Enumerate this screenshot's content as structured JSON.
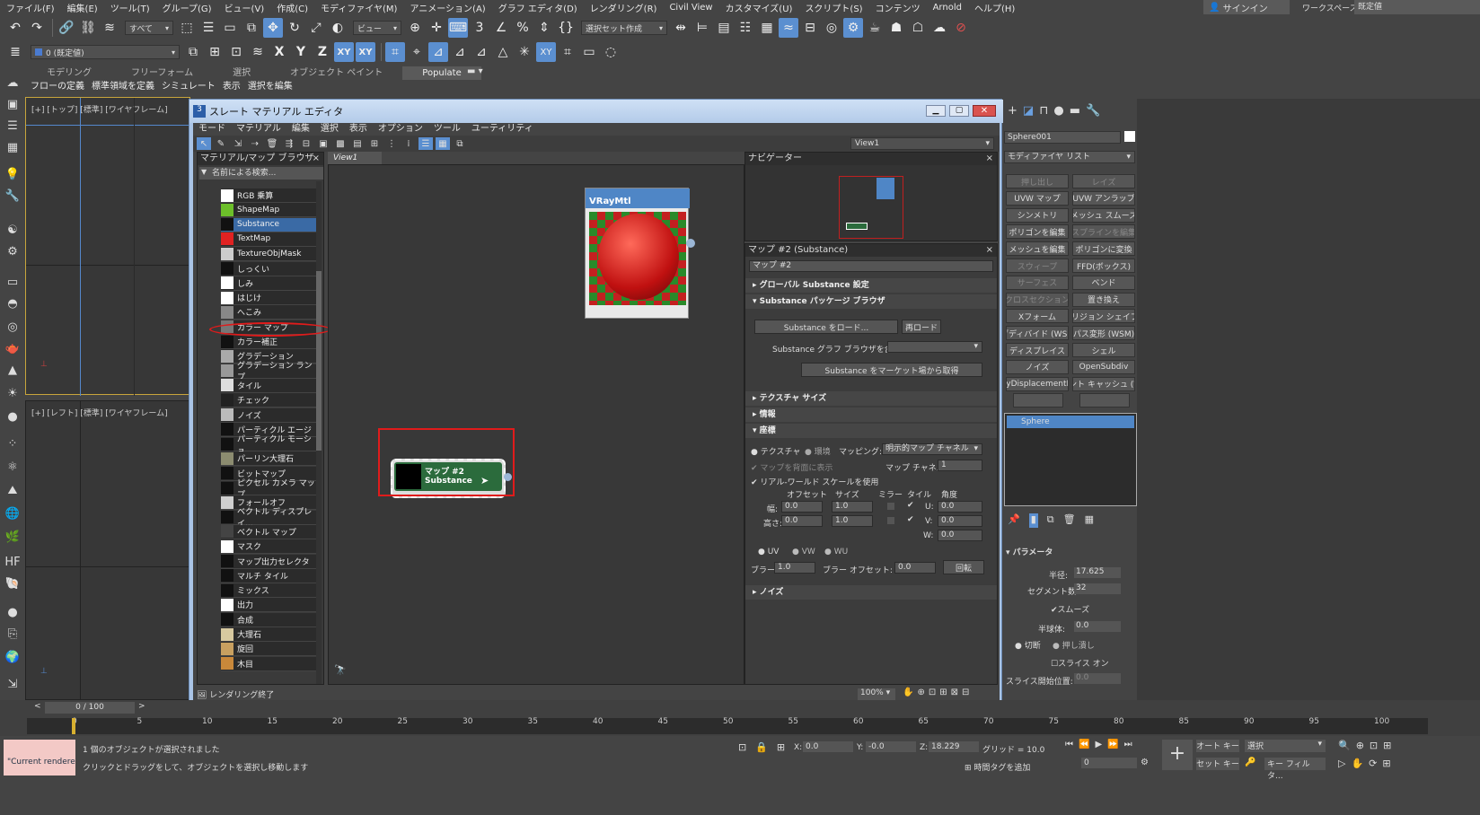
{
  "menubar": {
    "items": [
      "ファイル(F)",
      "編集(E)",
      "ツール(T)",
      "グループ(G)",
      "ビュー(V)",
      "作成(C)",
      "モディファイヤ(M)",
      "アニメーション(A)",
      "グラフ エディタ(D)",
      "レンダリング(R)",
      "Civil View",
      "カスタマイズ(U)",
      "スクリプト(S)",
      "コンテンツ",
      "Arnold",
      "ヘルプ(H)"
    ],
    "signin": "サインイン",
    "workspace_label": "ワークスペース:",
    "workspace_value": "既定値"
  },
  "toolbar1": {
    "selection_filter": "すべて",
    "refcoord": "ビュー",
    "named_selection": "選択セット作成"
  },
  "toolbar2": {
    "layer": "0 (既定値)",
    "axis_x": "X",
    "axis_y": "Y",
    "axis_z": "Z",
    "axis_xy": "XY",
    "axis_xy2": "XY"
  },
  "ribbon": {
    "tabs": [
      "モデリング",
      "フリーフォーム",
      "選択",
      "オブジェクト ペイント",
      "Populate"
    ],
    "sub": [
      "フローの定義",
      "標準領域を定義",
      "シミュレート",
      "表示",
      "選択を編集"
    ]
  },
  "viewports": {
    "top_label": "[+] [トップ] [標準] [ワイヤフレーム]",
    "left_label": "[+] [レフト] [標準] [ワイヤフレーム]"
  },
  "slate": {
    "title": "スレート マテリアル エディタ",
    "menu": [
      "モード",
      "マテリアル",
      "編集",
      "選択",
      "表示",
      "オプション",
      "ツール",
      "ユーティリティ"
    ],
    "view_dropdown": "View1",
    "browser_title": "マテリアル/マップ ブラウザ",
    "search_placeholder": "名前による検索...",
    "browser_items": [
      {
        "label": "RGB 乗算",
        "color": "#ffffff"
      },
      {
        "label": "ShapeMap",
        "color": "#6cbf2a"
      },
      {
        "label": "Substance",
        "color": "#111111"
      },
      {
        "label": "TextMap",
        "color": "#e02222"
      },
      {
        "label": "TextureObjMask",
        "color": "#cccccc"
      },
      {
        "label": "しっくい",
        "color": "#111111"
      },
      {
        "label": "しみ",
        "color": "#ffffff"
      },
      {
        "label": "はじけ",
        "color": "#ffffff"
      },
      {
        "label": "へこみ",
        "color": "#888888"
      },
      {
        "label": "カラー マップ",
        "color": "#777777"
      },
      {
        "label": "カラー補正",
        "color": "#111111"
      },
      {
        "label": "グラデーション",
        "color": "#aaaaaa"
      },
      {
        "label": "グラデーション ランプ",
        "color": "#999999"
      },
      {
        "label": "タイル",
        "color": "#dddddd"
      },
      {
        "label": "チェック",
        "color": "#222222"
      },
      {
        "label": "ノイズ",
        "color": "#bbbbbb"
      },
      {
        "label": "パーティクル エージ",
        "color": "#111111"
      },
      {
        "label": "パーティクル モーショ...",
        "color": "#111111"
      },
      {
        "label": "パーリン大理石",
        "color": "#8c8c70"
      },
      {
        "label": "ビットマップ",
        "color": "#111111"
      },
      {
        "label": "ピクセル カメラ マップ",
        "color": "#111111"
      },
      {
        "label": "フォールオフ",
        "color": "#cfcfcf"
      },
      {
        "label": "ベクトル ディスプレイ...",
        "color": "#111111"
      },
      {
        "label": "ベクトル マップ",
        "color": "#444444"
      },
      {
        "label": "マスク",
        "color": "#ffffff"
      },
      {
        "label": "マップ出力セレクタ",
        "color": "#111111"
      },
      {
        "label": "マルチ タイル",
        "color": "#111111"
      },
      {
        "label": "ミックス",
        "color": "#111111"
      },
      {
        "label": "出力",
        "color": "#ffffff"
      },
      {
        "label": "合成",
        "color": "#111111"
      },
      {
        "label": "大理石",
        "color": "#d7c9a0"
      },
      {
        "label": "旋回",
        "color": "#c8a060"
      },
      {
        "label": "木目",
        "color": "#c9883a"
      }
    ],
    "view_tab": "View1",
    "vray_node_label": "VRayMtl",
    "map_node_title": "マップ #2",
    "map_node_sub": "Substance",
    "navigator_title": "ナビゲーター",
    "param_title": "マップ #2 (Substance)",
    "param_name": "マップ #2",
    "sections": {
      "global": "グローバル Substance 設定",
      "pkg": "Substance パッケージ ブラウザ",
      "texsize": "テクスチャ サイズ",
      "info": "情報",
      "coords": "座標",
      "noise": "ノイズ"
    },
    "btn_load": "Substance をロード...",
    "btn_reload": "再ロード",
    "graph_label": "Substance グラフ ブラウザを含む：",
    "btn_market": "Substance をマーケット場から取得",
    "coords": {
      "texture": "テクスチャ",
      "env": "環境",
      "mapping_label": "マッピング:",
      "mapping_value": "明示的マップ チャネル",
      "show_back": "マップを背面に表示",
      "channel_label": "マップ チャネル:",
      "channel_value": "1",
      "realworld": "リアル-ワールド スケールを使用",
      "h_offset": "オフセット",
      "h_size": "サイズ",
      "h_mirror": "ミラー",
      "h_tile": "タイル",
      "h_angle": "角度",
      "width": "幅:",
      "height": "高さ:",
      "u_off": "0.0",
      "u_size": "1.0",
      "v_off": "0.0",
      "v_size": "1.0",
      "u_lbl": "U:",
      "v_lbl": "V:",
      "w_lbl": "W:",
      "u_ang": "0.0",
      "v_ang": "0.0",
      "w_ang": "0.0",
      "uv": "UV",
      "vw": "VW",
      "wu": "WU",
      "blur_label": "ブラー:",
      "blur_value": "1.0",
      "blur_off_label": "ブラー オフセット:",
      "blur_off_value": "0.0",
      "rotate": "回転"
    },
    "status_text": "レンダリング終了",
    "zoom": "100%"
  },
  "command_panel": {
    "object_name": "Sphere001",
    "modifier_list": "モディファイヤ リスト",
    "buttons": [
      [
        "押し出し",
        "レイズ"
      ],
      [
        "UVW マップ",
        "UVW アンラップ"
      ],
      [
        "シンメトリ",
        "メッシュ スムーズ"
      ],
      [
        "ポリゴンを編集",
        "スプラインを編集"
      ],
      [
        "メッシュを編集",
        "ポリゴンに変換"
      ],
      [
        "スウィープ",
        "FFD(ボックス)"
      ],
      [
        "サーフェス",
        "ベンド"
      ],
      [
        "クロスセクション",
        "置き換え"
      ],
      [
        "Xフォーム",
        "コリジョン シェイプ ("
      ],
      [
        "ブディバイド (WSM",
        "パス変形 (WSM)"
      ],
      [
        "ディスプレイス",
        "シェル"
      ],
      [
        "ノイズ",
        "OpenSubdiv"
      ],
      [
        "ayDisplacementM",
        "イント キャッシュ (WS"
      ]
    ],
    "stack_item": "Sphere",
    "params_title": "パラメータ",
    "radius_label": "半径:",
    "radius_value": "17.625",
    "segments_label": "セグメント数:",
    "segments_value": "32",
    "smooth": "スムーズ",
    "hemi_label": "半球体:",
    "hemi_value": "0.0",
    "chop": "切断",
    "squash": "押し潰し",
    "slice_on": "スライス オン",
    "slice_from": "スライス開始位置:",
    "slice_from_value": "0.0"
  },
  "timeline": {
    "frame": "0 / 100",
    "ticks": [
      "0",
      "5",
      "10",
      "15",
      "20",
      "25",
      "30",
      "35",
      "40",
      "45",
      "50",
      "55",
      "60",
      "65",
      "70",
      "75",
      "80",
      "85",
      "90",
      "95",
      "100"
    ]
  },
  "status": {
    "script_text": "\"Current rendere",
    "selected": "1 個のオブジェクトが選択されました",
    "hint": "クリックとドラッグをして、オブジェクトを選択し移動します",
    "x_label": "X:",
    "x_value": "0.0",
    "y_label": "Y:",
    "y_value": "-0.0",
    "z_label": "Z:",
    "z_value": "18.229",
    "grid": "グリッド = 10.0",
    "add_time_tag": "時間タグを追加",
    "auto_key": "オート キー",
    "set_key": "セット キー",
    "sel_mode": "選択",
    "key_filter": "キー フィルタ...",
    "frame_value": "0"
  },
  "colors": {
    "accent": "#5b8fd0",
    "highlight_red": "#e01b1b",
    "node_green": "#2b6b3c"
  }
}
